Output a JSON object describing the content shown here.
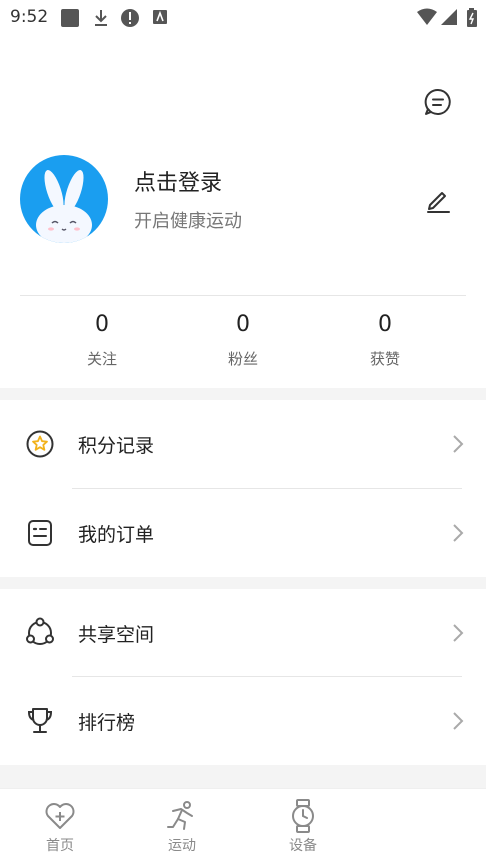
{
  "status_bar": {
    "time": "9:52"
  },
  "profile": {
    "login_prompt": "点击登录",
    "tagline": "开启健康运动"
  },
  "stats": [
    {
      "value": "0",
      "label": "关注"
    },
    {
      "value": "0",
      "label": "粉丝"
    },
    {
      "value": "0",
      "label": "获赞"
    }
  ],
  "menu": {
    "points": "积分记录",
    "orders": "我的订单",
    "shared_space": "共享空间",
    "leaderboard": "排行榜"
  },
  "tabs": {
    "home": "首页",
    "sport": "运动",
    "device": "设备"
  },
  "icons": {
    "message": "message-icon",
    "edit": "edit-icon",
    "star": "star-badge-icon",
    "order": "order-icon",
    "share": "share-icon",
    "trophy": "trophy-icon",
    "chevron": "chevron-right-icon"
  },
  "colors": {
    "avatar_bg": "#1a9ef0",
    "gap_bg": "#f4f4f4",
    "star_accent": "#f2b21b"
  }
}
